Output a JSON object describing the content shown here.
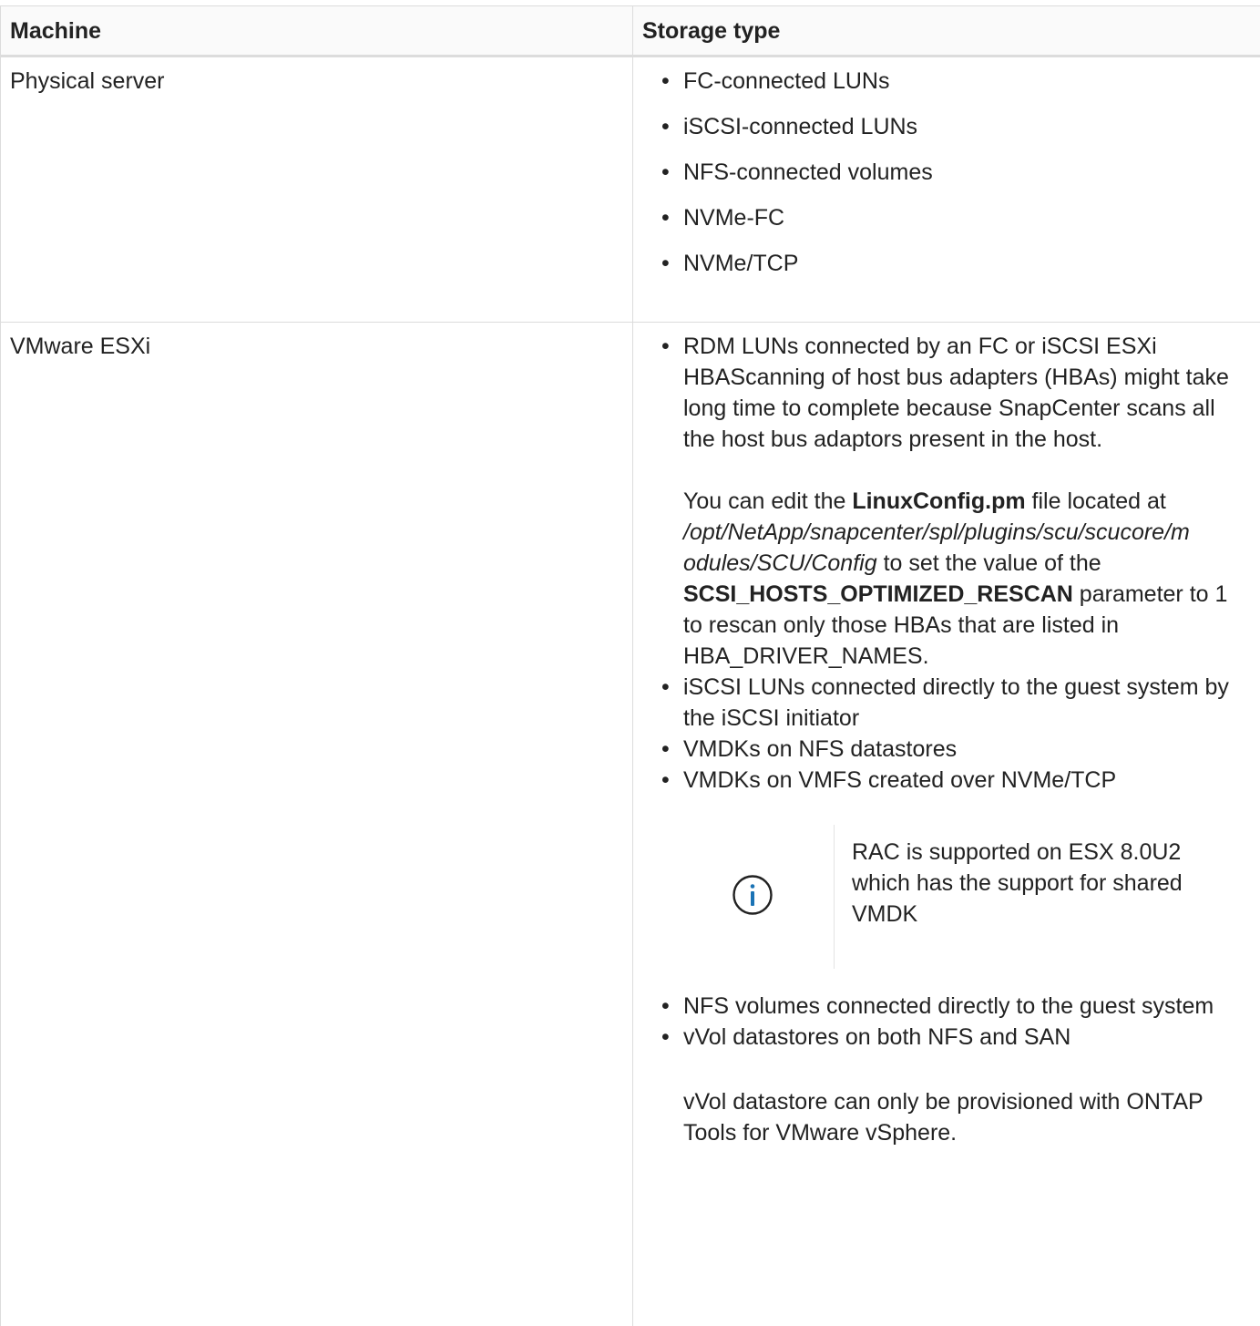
{
  "table": {
    "headers": [
      "Machine",
      "Storage type"
    ],
    "rows": [
      {
        "machine": "Physical server",
        "items": [
          "FC-connected LUNs",
          "iSCSI-connected LUNs",
          "NFS-connected volumes",
          "NVMe-FC",
          "NVMe/TCP"
        ]
      },
      {
        "machine": "VMware ESXi",
        "rdm_item": "RDM LUNs connected by an FC or iSCSI ESXi HBAScanning of host bus adapters (HBAs) might take long time to complete because SnapCenter scans all the host bus adaptors present in the host.",
        "edit_note": {
          "p1": "You can edit the ",
          "file": "LinuxConfig.pm",
          "p2": " file located at ",
          "path_line1": "/opt/NetApp/snapcenter/spl/plugins/scu/scucore/m",
          "path_line2": "odules/SCU/Config",
          "p3": " to set the value of the ",
          "param": "SCSI_HOSTS_OPTIMIZED_RESCAN",
          "p4": " parameter to 1 to rescan only those HBAs that are listed in HBA_DRIVER_NAMES."
        },
        "items_a": [
          "iSCSI LUNs connected directly to the guest system by the iSCSI initiator",
          "VMDKs on NFS datastores",
          "VMDKs on VMFS created over NVMe/TCP"
        ],
        "info_note": "RAC is supported on ESX 8.0U2 which has the support for shared VMDK",
        "items_b": [
          "NFS volumes connected directly to the guest system",
          "vVol datastores on both NFS and SAN"
        ],
        "vvol_note": "vVol datastore can only be provisioned with ONTAP Tools for VMware vSphere."
      }
    ]
  },
  "bullet_char": "•",
  "colors": {
    "info_icon": "#1a73b5",
    "border": "#dcdcdc",
    "header_bg": "#fafafa",
    "text": "#222222"
  },
  "icons": {
    "note_icon": "info-icon"
  }
}
